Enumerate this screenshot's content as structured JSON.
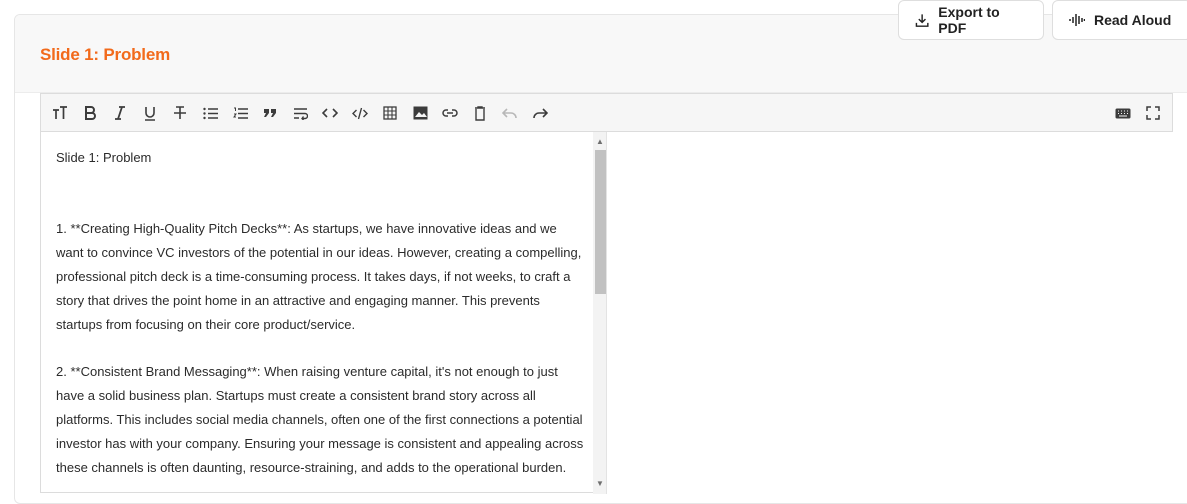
{
  "slide": {
    "title": "Slide 1: Problem"
  },
  "actions": {
    "export_label": "Export to PDF",
    "read_label": "Read Aloud"
  },
  "toolbar": {
    "buttons": [
      {
        "name": "heading-icon",
        "disabled": false
      },
      {
        "name": "bold-icon",
        "disabled": false
      },
      {
        "name": "italic-icon",
        "disabled": false
      },
      {
        "name": "underline-icon",
        "disabled": false
      },
      {
        "name": "strikethrough-icon",
        "disabled": false
      },
      {
        "name": "bullet-list-icon",
        "disabled": false
      },
      {
        "name": "numbered-list-icon",
        "disabled": false
      },
      {
        "name": "quote-icon",
        "disabled": false
      },
      {
        "name": "line-break-icon",
        "disabled": false
      },
      {
        "name": "inline-code-icon",
        "disabled": false
      },
      {
        "name": "code-block-icon",
        "disabled": false
      },
      {
        "name": "table-icon",
        "disabled": false
      },
      {
        "name": "image-icon",
        "disabled": false
      },
      {
        "name": "link-icon",
        "disabled": false
      },
      {
        "name": "clear-icon",
        "disabled": false
      },
      {
        "name": "undo-icon",
        "disabled": true
      },
      {
        "name": "redo-icon",
        "disabled": false
      },
      {
        "name": "keyboard-icon",
        "disabled": false
      },
      {
        "name": "fullscreen-icon",
        "disabled": false
      }
    ]
  },
  "editor": {
    "content": {
      "heading_line": "Slide 1: Problem",
      "para1": "1. **Creating High-Quality Pitch Decks**: As startups, we have innovative ideas and we want to convince VC investors of the potential in our ideas. However, creating a compelling, professional pitch deck is a time-consuming process. It takes days, if not weeks, to craft a story that drives the point home in an attractive and engaging manner. This prevents startups from focusing on their core product/service.",
      "para2": "2. **Consistent Brand Messaging**: When raising venture capital, it's not enough to just have a solid business plan. Startups must create a consistent brand story across all platforms. This includes social media channels, often one of the first connections a potential investor has with your company. Ensuring your message is consistent and appealing across these channels is often daunting, resource-straining, and adds to the operational burden."
    }
  }
}
